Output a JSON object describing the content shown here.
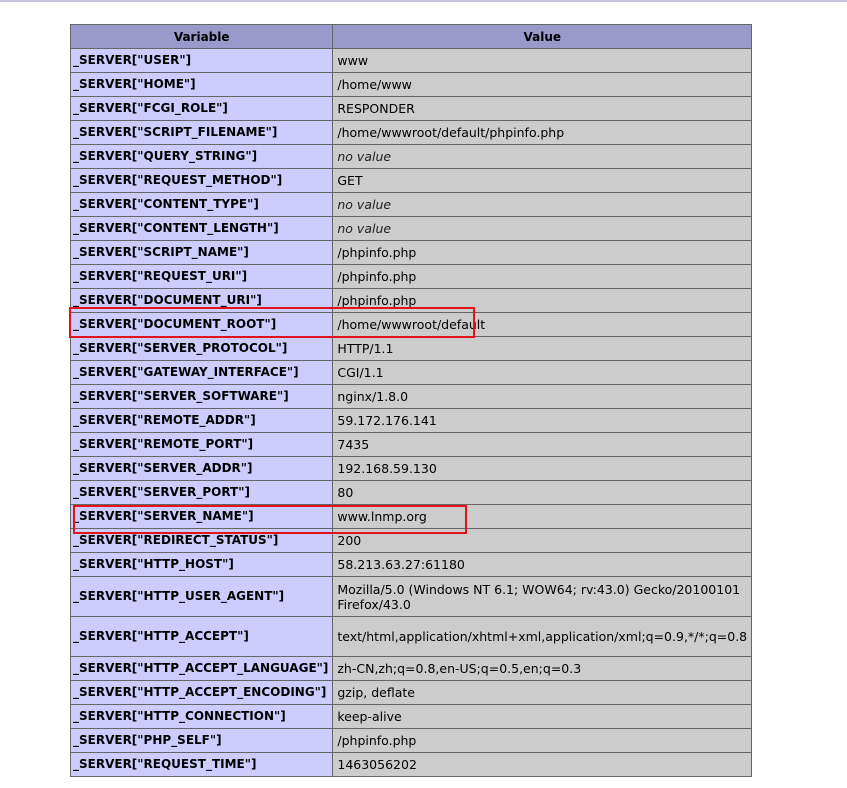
{
  "table": {
    "headers": {
      "variable": "Variable",
      "value": "Value"
    },
    "rows": [
      {
        "variable": "_SERVER[\"USER\"]",
        "value": "www",
        "no_value": false
      },
      {
        "variable": "_SERVER[\"HOME\"]",
        "value": "/home/www",
        "no_value": false
      },
      {
        "variable": "_SERVER[\"FCGI_ROLE\"]",
        "value": "RESPONDER",
        "no_value": false
      },
      {
        "variable": "_SERVER[\"SCRIPT_FILENAME\"]",
        "value": "/home/wwwroot/default/phpinfo.php",
        "no_value": false
      },
      {
        "variable": "_SERVER[\"QUERY_STRING\"]",
        "value": "no value",
        "no_value": true
      },
      {
        "variable": "_SERVER[\"REQUEST_METHOD\"]",
        "value": "GET",
        "no_value": false
      },
      {
        "variable": "_SERVER[\"CONTENT_TYPE\"]",
        "value": "no value",
        "no_value": true
      },
      {
        "variable": "_SERVER[\"CONTENT_LENGTH\"]",
        "value": "no value",
        "no_value": true
      },
      {
        "variable": "_SERVER[\"SCRIPT_NAME\"]",
        "value": "/phpinfo.php",
        "no_value": false
      },
      {
        "variable": "_SERVER[\"REQUEST_URI\"]",
        "value": "/phpinfo.php",
        "no_value": false
      },
      {
        "variable": "_SERVER[\"DOCUMENT_URI\"]",
        "value": "/phpinfo.php",
        "no_value": false
      },
      {
        "variable": "_SERVER[\"DOCUMENT_ROOT\"]",
        "value": "/home/wwwroot/default",
        "no_value": false
      },
      {
        "variable": "_SERVER[\"SERVER_PROTOCOL\"]",
        "value": "HTTP/1.1",
        "no_value": false
      },
      {
        "variable": "_SERVER[\"GATEWAY_INTERFACE\"]",
        "value": "CGI/1.1",
        "no_value": false
      },
      {
        "variable": "_SERVER[\"SERVER_SOFTWARE\"]",
        "value": "nginx/1.8.0",
        "no_value": false
      },
      {
        "variable": "_SERVER[\"REMOTE_ADDR\"]",
        "value": "59.172.176.141",
        "no_value": false
      },
      {
        "variable": "_SERVER[\"REMOTE_PORT\"]",
        "value": "7435",
        "no_value": false
      },
      {
        "variable": "_SERVER[\"SERVER_ADDR\"]",
        "value": "192.168.59.130",
        "no_value": false
      },
      {
        "variable": "_SERVER[\"SERVER_PORT\"]",
        "value": "80",
        "no_value": false
      },
      {
        "variable": "_SERVER[\"SERVER_NAME\"]",
        "value": "www.lnmp.org",
        "no_value": false
      },
      {
        "variable": "_SERVER[\"REDIRECT_STATUS\"]",
        "value": "200",
        "no_value": false
      },
      {
        "variable": "_SERVER[\"HTTP_HOST\"]",
        "value": "58.213.63.27:61180",
        "no_value": false
      },
      {
        "variable": "_SERVER[\"HTTP_USER_AGENT\"]",
        "value": "Mozilla/5.0 (Windows NT 6.1; WOW64; rv:43.0) Gecko/20100101 Firefox/43.0",
        "no_value": false,
        "two_line": true
      },
      {
        "variable": "_SERVER[\"HTTP_ACCEPT\"]",
        "value": "text/html,application/xhtml+xml,application/xml;q=0.9,*/*;q=0.8",
        "no_value": false,
        "two_line": true
      },
      {
        "variable": "_SERVER[\"HTTP_ACCEPT_LANGUAGE\"]",
        "value": "zh-CN,zh;q=0.8,en-US;q=0.5,en;q=0.3",
        "no_value": false
      },
      {
        "variable": "_SERVER[\"HTTP_ACCEPT_ENCODING\"]",
        "value": "gzip, deflate",
        "no_value": false
      },
      {
        "variable": "_SERVER[\"HTTP_CONNECTION\"]",
        "value": "keep-alive",
        "no_value": false
      },
      {
        "variable": "_SERVER[\"PHP_SELF\"]",
        "value": "/phpinfo.php",
        "no_value": false
      },
      {
        "variable": "_SERVER[\"REQUEST_TIME\"]",
        "value": "1463056202",
        "no_value": false
      }
    ]
  },
  "colors": {
    "header_bg": "#9999cc",
    "variable_bg": "#ccccff",
    "value_bg": "#cccccc",
    "highlight": "#e0141d"
  }
}
